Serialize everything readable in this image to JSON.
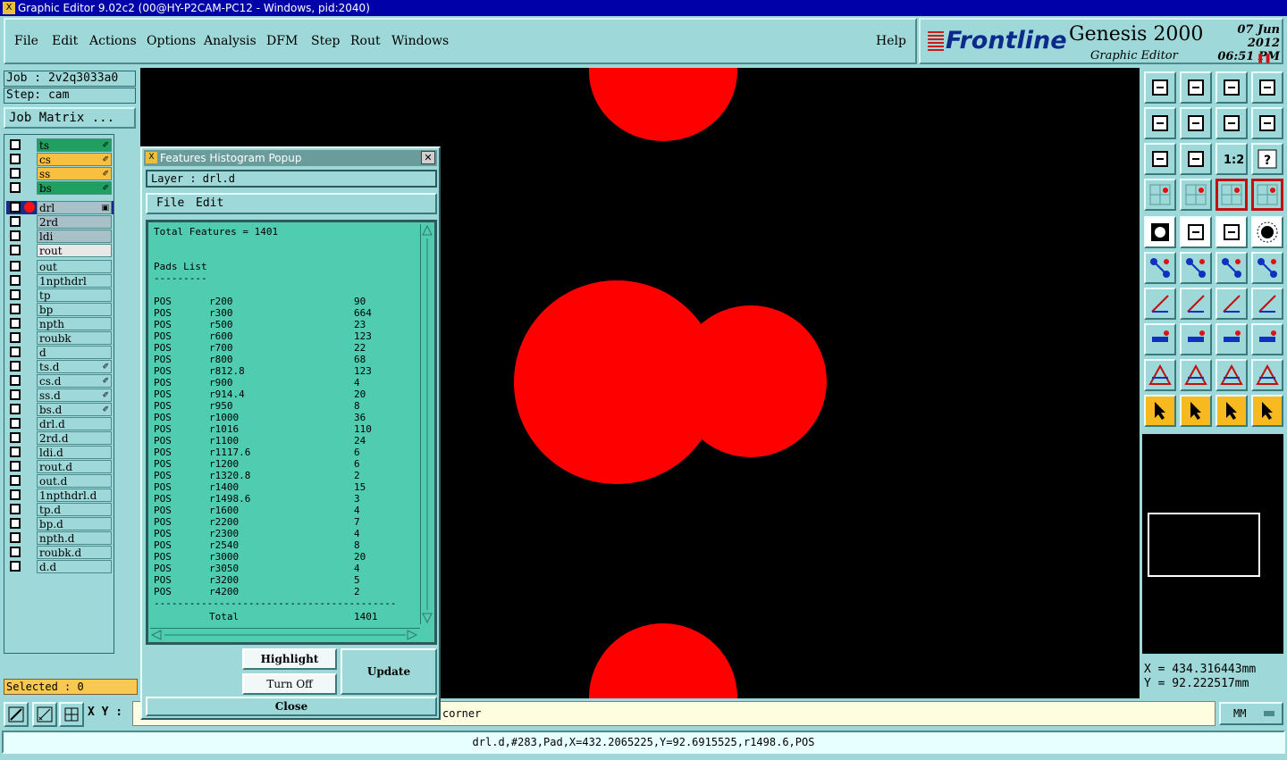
{
  "window": {
    "title": "Graphic Editor 9.02c2 (00@HY-P2CAM-PC12 - Windows, pid:2040)"
  },
  "menu": [
    "File",
    "Edit",
    "Actions",
    "Options",
    "Analysis",
    "DFM",
    "Step",
    "Rout",
    "Windows"
  ],
  "help": "Help",
  "brand": {
    "name": "Frontline",
    "product": "Genesis 2000",
    "subtitle": "Graphic Editor",
    "date": "07 Jun 2012",
    "time": "06:51 PM"
  },
  "job": {
    "label": "Job : 2v2q3033a0",
    "step": "Step: cam",
    "matrix_button": "Job Matrix ..."
  },
  "layers": [
    {
      "name": "ts",
      "color": "#20a060",
      "mark": "✐"
    },
    {
      "name": "cs",
      "color": "#f8c040",
      "mark": "✐"
    },
    {
      "name": "ss",
      "color": "#f8c040",
      "mark": "✐"
    },
    {
      "name": "bs",
      "color": "#20a060",
      "mark": "✐"
    },
    {
      "name": "drl",
      "color": "#a8c0c8",
      "mark": "▣",
      "active": true
    },
    {
      "name": "2rd",
      "color": "#a8c0c8",
      "mark": ""
    },
    {
      "name": "ldi",
      "color": "#a8c0c8",
      "mark": ""
    },
    {
      "name": "rout",
      "color": "#e8e8e8",
      "mark": ""
    },
    {
      "name": "out",
      "color": "#9fd8d8",
      "mark": ""
    },
    {
      "name": "1npthdrl",
      "color": "#9fd8d8",
      "mark": ""
    },
    {
      "name": "tp",
      "color": "#9fd8d8",
      "mark": ""
    },
    {
      "name": "bp",
      "color": "#9fd8d8",
      "mark": ""
    },
    {
      "name": "npth",
      "color": "#9fd8d8",
      "mark": ""
    },
    {
      "name": "roubk",
      "color": "#9fd8d8",
      "mark": ""
    },
    {
      "name": "d",
      "color": "#9fd8d8",
      "mark": ""
    },
    {
      "name": "ts.d",
      "color": "#9fd8d8",
      "mark": "✐"
    },
    {
      "name": "cs.d",
      "color": "#9fd8d8",
      "mark": "✐"
    },
    {
      "name": "ss.d",
      "color": "#9fd8d8",
      "mark": "✐"
    },
    {
      "name": "bs.d",
      "color": "#9fd8d8",
      "mark": "✐"
    },
    {
      "name": "drl.d",
      "color": "#9fd8d8",
      "mark": ""
    },
    {
      "name": "2rd.d",
      "color": "#9fd8d8",
      "mark": ""
    },
    {
      "name": "ldi.d",
      "color": "#9fd8d8",
      "mark": ""
    },
    {
      "name": "rout.d",
      "color": "#9fd8d8",
      "mark": ""
    },
    {
      "name": "out.d",
      "color": "#9fd8d8",
      "mark": ""
    },
    {
      "name": "1npthdrl.d",
      "color": "#9fd8d8",
      "mark": ""
    },
    {
      "name": "tp.d",
      "color": "#9fd8d8",
      "mark": ""
    },
    {
      "name": "bp.d",
      "color": "#9fd8d8",
      "mark": ""
    },
    {
      "name": "npth.d",
      "color": "#9fd8d8",
      "mark": ""
    },
    {
      "name": "roubk.d",
      "color": "#9fd8d8",
      "mark": ""
    },
    {
      "name": "d.d",
      "color": "#9fd8d8",
      "mark": ""
    }
  ],
  "selected": "Selected : 0",
  "popup": {
    "title": "Features Histogram Popup",
    "layer": "Layer :  drl.d",
    "menu": [
      "File",
      "Edit"
    ],
    "total": "Total Features = 1401",
    "pads_header": "Pads List",
    "pads_underline": "---------",
    "rows": [
      [
        "POS",
        "r200",
        "90"
      ],
      [
        "POS",
        "r300",
        "664"
      ],
      [
        "POS",
        "r500",
        "23"
      ],
      [
        "POS",
        "r600",
        "123"
      ],
      [
        "POS",
        "r700",
        "22"
      ],
      [
        "POS",
        "r800",
        "68"
      ],
      [
        "POS",
        "r812.8",
        "123"
      ],
      [
        "POS",
        "r900",
        "4"
      ],
      [
        "POS",
        "r914.4",
        "20"
      ],
      [
        "POS",
        "r950",
        "8"
      ],
      [
        "POS",
        "r1000",
        "36"
      ],
      [
        "POS",
        "r1016",
        "110"
      ],
      [
        "POS",
        "r1100",
        "24"
      ],
      [
        "POS",
        "r1117.6",
        "6"
      ],
      [
        "POS",
        "r1200",
        "6"
      ],
      [
        "POS",
        "r1320.8",
        "2"
      ],
      [
        "POS",
        "r1400",
        "15"
      ],
      [
        "POS",
        "r1498.6",
        "3"
      ],
      [
        "POS",
        "r1600",
        "4"
      ],
      [
        "POS",
        "r2200",
        "7"
      ],
      [
        "POS",
        "r2300",
        "4"
      ],
      [
        "POS",
        "r2540",
        "8"
      ],
      [
        "POS",
        "r3000",
        "20"
      ],
      [
        "POS",
        "r3050",
        "4"
      ],
      [
        "POS",
        "r3200",
        "5"
      ],
      [
        "POS",
        "r4200",
        "2"
      ]
    ],
    "separator": "-----------------------------------------",
    "total_label": "Total",
    "total_value": "1401",
    "buttons": {
      "highlight": "Highlight",
      "turn_off": "Turn Off",
      "update": "Update",
      "close": "Close"
    }
  },
  "coords": {
    "x": "X = 434.316443mm",
    "y": "Y = 92.222517mm"
  },
  "bottom": {
    "xy_label": "X Y :",
    "message": "corner",
    "units": "MM"
  },
  "status": "drl.d,#283,Pad,X=432.2065225,Y=92.6915525,r1498.6,POS"
}
